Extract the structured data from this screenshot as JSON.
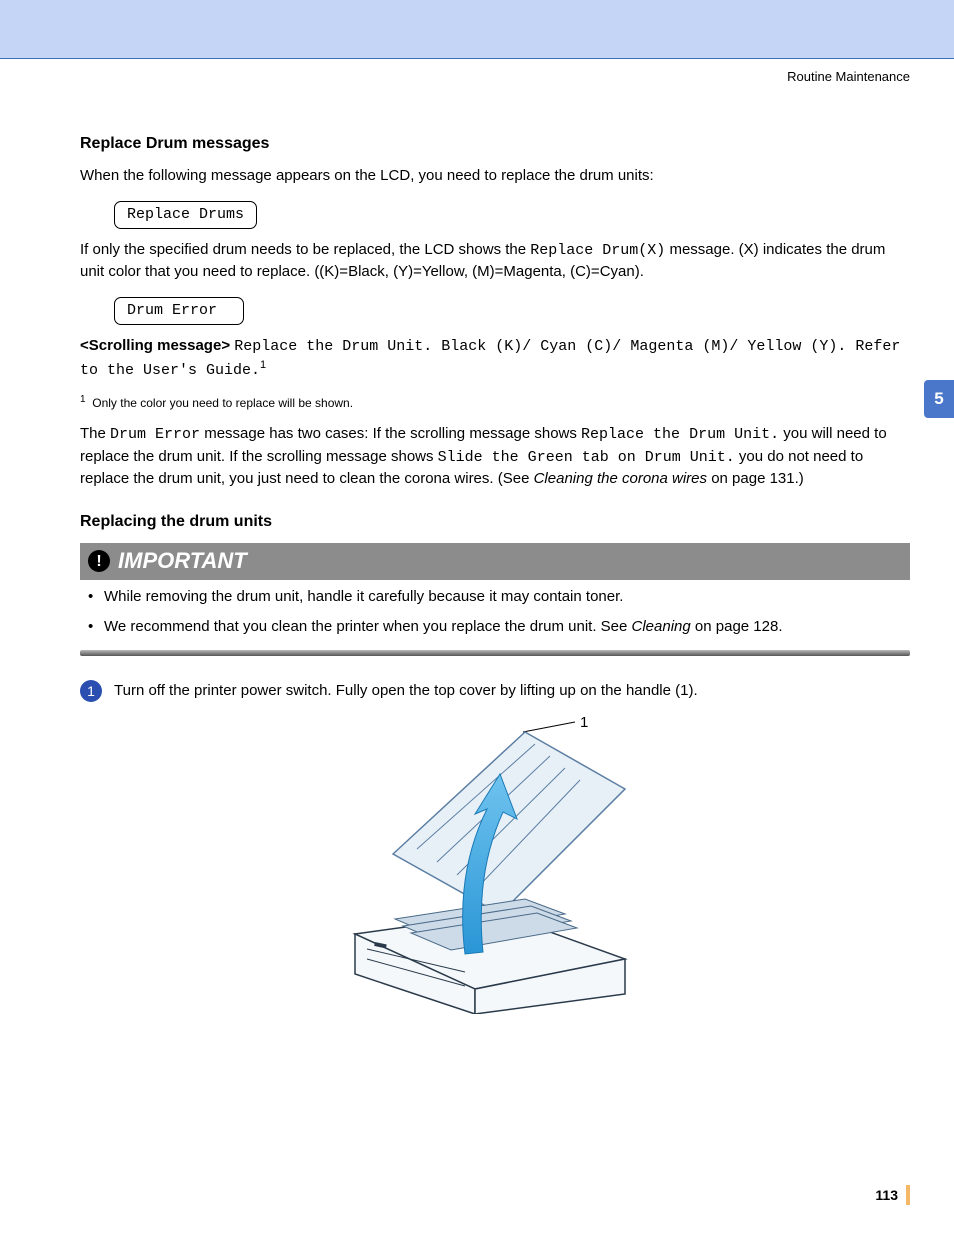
{
  "header": {
    "section": "Routine Maintenance"
  },
  "sideTab": "5",
  "pageNumber": "113",
  "h1": "Replace Drum messages",
  "p1": "When the following message appears on the LCD, you need to replace the drum units:",
  "lcd1": "Replace Drums",
  "p2a": "If only the specified drum needs to be replaced, the LCD shows the ",
  "p2mono": "Replace Drum(X)",
  "p2b": " message. (X) indicates the drum unit color that you need to replace. ((K)=Black, (Y)=Yellow, (M)=Magenta, (C)=Cyan).",
  "lcd2": "Drum Error",
  "scrollLabel": "<Scrolling message>",
  "scrollMono": "Replace the Drum Unit. Black (K)/ Cyan (C)/ Magenta (M)/ Yellow (Y). Refer to the User's Guide.",
  "footnoteNum": "1",
  "footnote": "Only the color you need to replace will be shown.",
  "p3a": "The ",
  "p3mono1": "Drum Error",
  "p3b": " message has two cases: If the scrolling message shows ",
  "p3mono2": "Replace the Drum Unit.",
  "p3c": " you will need to replace the drum unit. If the scrolling message shows ",
  "p3mono3": "Slide the Green tab on Drum Unit.",
  "p3d": " you do not need to replace the drum unit, you just need to clean the corona wires. (See ",
  "p3link": "Cleaning the corona wires",
  "p3e": " on page 131.)",
  "h2": "Replacing the drum units",
  "importantLabel": "IMPORTANT",
  "imp1": "While removing the drum unit, handle it carefully because it may contain toner.",
  "imp2a": "We recommend that you clean the printer when you replace the drum unit. See ",
  "imp2link": "Cleaning",
  "imp2b": " on page 128.",
  "stepNum": "1",
  "stepText": "Turn off the printer power switch. Fully open the top cover by lifting up on the handle (1).",
  "figureLabel": "1"
}
